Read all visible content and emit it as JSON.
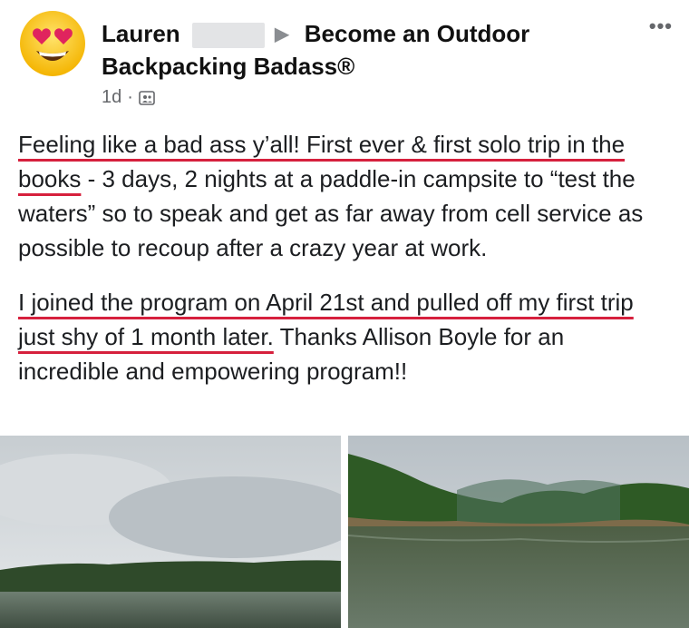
{
  "post": {
    "author": "Lauren",
    "group_line1": "Become an Outdoor",
    "group_line2": "Backpacking Badass®",
    "time": "1d",
    "dot": "·",
    "more": "•••",
    "paragraph1": {
      "hl1": "Feeling like a bad ass y’all! First ever & first solo trip in the books",
      "rest": " - 3 days, 2 nights at a paddle-in campsite to “test the waters” so to speak and get as far away from cell service as possible to recoup after a crazy year at work."
    },
    "paragraph2": {
      "hl2": "I joined the program on April 21st and pulled off my first trip just shy of 1 month later.",
      "rest": " Thanks Allison Boyle for an incredible and empowering program!!"
    }
  },
  "icons": {
    "avatar": "heart-eyes-emoji-icon",
    "privacy": "group-members-icon",
    "more": "more-options-icon"
  },
  "colors": {
    "underline": "#d6203d",
    "meta": "#65676b"
  }
}
